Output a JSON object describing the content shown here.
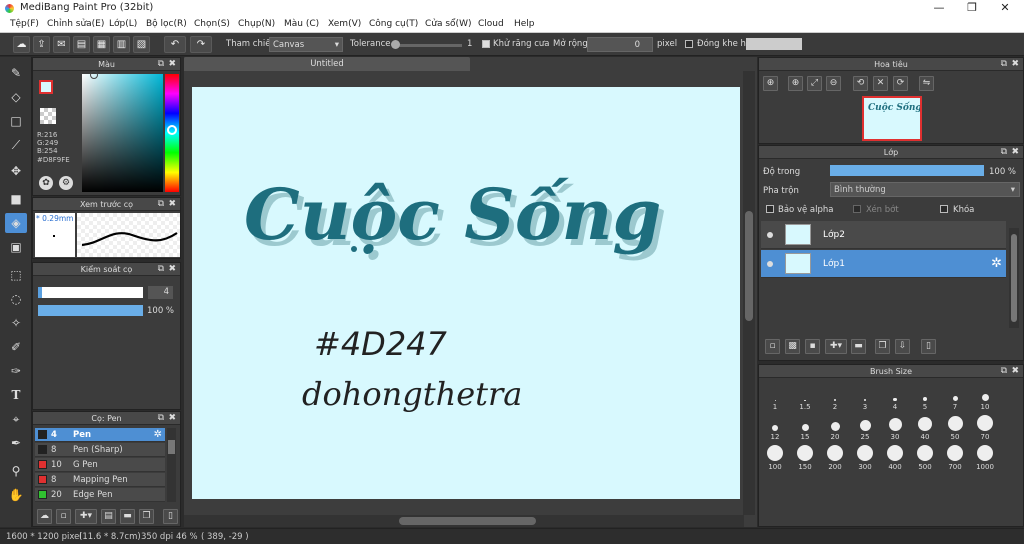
{
  "window": {
    "title": "MediBang Paint Pro (32bit)",
    "min": "—",
    "max": "❐",
    "close": "✕"
  },
  "menu": [
    "Tệp(F)",
    "Chỉnh sửa(E)",
    "Lớp(L)",
    "Bộ lọc(R)",
    "Chọn(S)",
    "Chụp(N)",
    "Màu (C)",
    "Xem(V)",
    "Công cụ(T)",
    "Cửa sổ(W)",
    "Cloud",
    "Help"
  ],
  "toolbar": {
    "reference_label": "Tham chiếu",
    "reference_value": "Canvas",
    "tolerance_label": "Tolerance",
    "tolerance_value": "1",
    "antialias_label": "Khử răng cưa",
    "expand_label": "Mở rộng",
    "expand_value": "0",
    "expand_unit": "pixel",
    "close_gap_label": "Đóng khe hở"
  },
  "color_panel": {
    "title": "Màu",
    "r": "R:216",
    "g": "G:249",
    "b": "B:254",
    "hex": "#D8F9FE",
    "fg": "#d8f9fe"
  },
  "brush_preview": {
    "title": "Xem trước cọ",
    "size": "0.29mm"
  },
  "brush_control": {
    "title": "Kiểm soát cọ",
    "size": "4",
    "opacity": "100 %",
    "opacity_fraction": 1.0
  },
  "brush_list": {
    "title": "Cọ: Pen",
    "items": [
      {
        "size": "4",
        "name": "Pen",
        "color": "#222222"
      },
      {
        "size": "8",
        "name": "Pen (Sharp)",
        "color": "#222222"
      },
      {
        "size": "10",
        "name": "G Pen",
        "color": "#e03030"
      },
      {
        "size": "8",
        "name": "Mapping Pen",
        "color": "#e03030"
      },
      {
        "size": "20",
        "name": "Edge Pen",
        "color": "#30c030"
      }
    ]
  },
  "canvas": {
    "tab": "Untitled",
    "bg": "#d8f9fe",
    "title_text": "Cuộc Sống",
    "hex_note": "#4D247",
    "signature": "dohongthetra",
    "ink": "#1e6e7e"
  },
  "navigator": {
    "title": "Hoa tiêu",
    "thumb_text": "Cuộc Sống"
  },
  "layer_panel": {
    "title": "Lớp",
    "opacity_label": "Độ trong",
    "opacity_value": "100 %",
    "opacity_fraction": 1.0,
    "blend_label": "Pha trộn",
    "blend_value": "Bình thường",
    "protect_alpha": "Bảo vệ alpha",
    "clipping": "Xén bớt",
    "lock": "Khóa",
    "layers": [
      {
        "name": "Lớp2"
      },
      {
        "name": "Lớp1"
      }
    ]
  },
  "brush_size": {
    "title": "Brush Size",
    "sizes": [
      "1",
      "1.5",
      "2",
      "3",
      "4",
      "5",
      "7",
      "10",
      "12",
      "15",
      "20",
      "25",
      "30",
      "40",
      "50",
      "70",
      "100",
      "150",
      "200",
      "300",
      "400",
      "500",
      "700",
      "1000"
    ]
  },
  "status": {
    "dims": "1600 * 1200 pixel",
    "phys": "(11.6 * 8.7cm)",
    "dpi": "350 dpi",
    "zoom": "46 %",
    "coords": "( 389, -29 )"
  }
}
